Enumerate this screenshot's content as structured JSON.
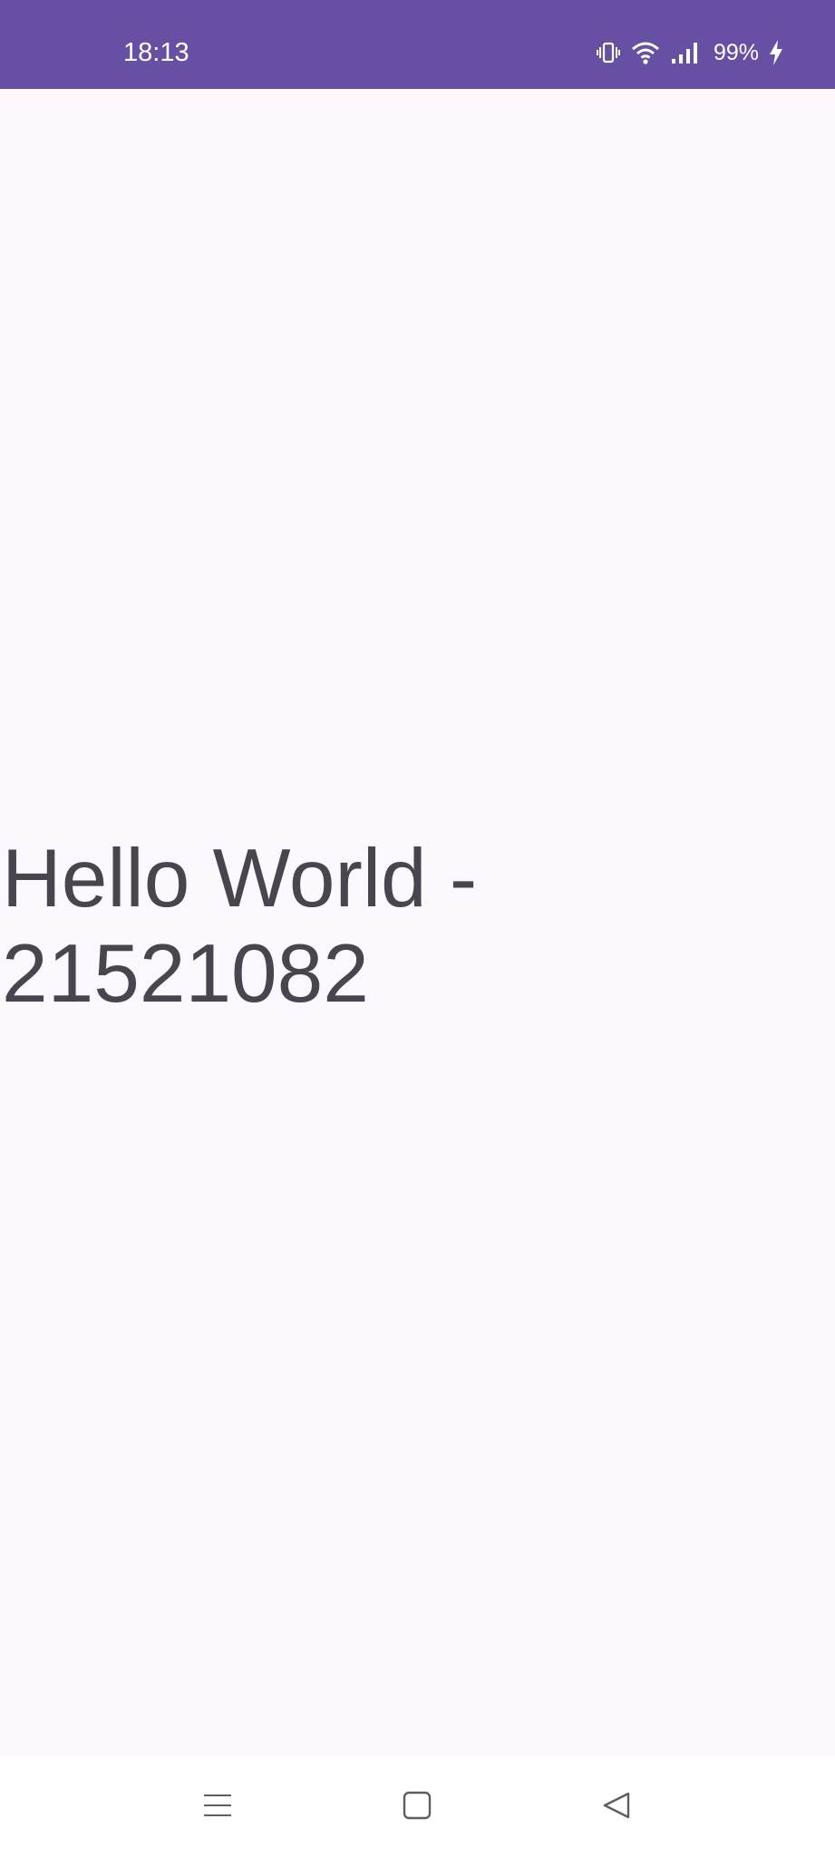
{
  "status_bar": {
    "time": "18:13",
    "battery": "99%",
    "icons": [
      "vibrate-icon",
      "wifi-icon",
      "signal-icon",
      "charging-icon"
    ],
    "background": "#6750a4"
  },
  "main": {
    "text": "Hello World - 21521082",
    "text_color": "#49454f",
    "background": "#fdf8fd"
  },
  "nav_bar": {
    "buttons": [
      "menu-icon",
      "home-icon",
      "back-icon"
    ]
  }
}
